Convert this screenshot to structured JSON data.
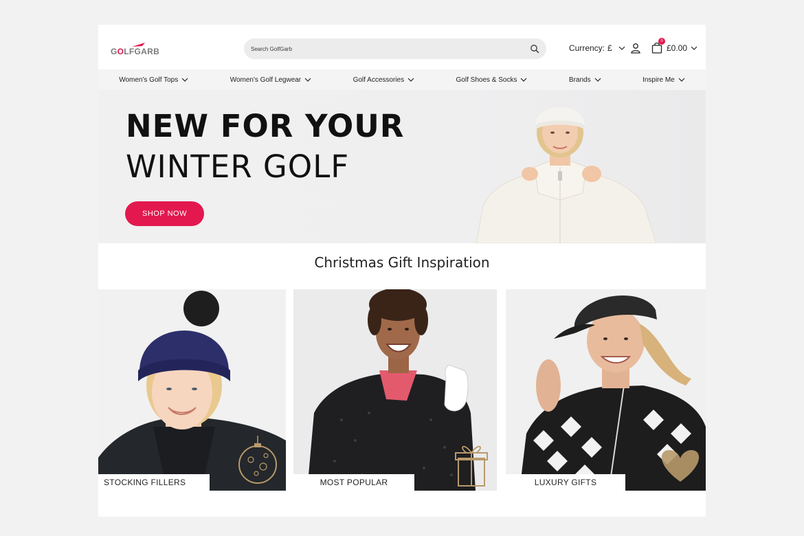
{
  "header": {
    "logo_text_pre": "G",
    "logo_text_o": "O",
    "logo_text_post": "LFGARB",
    "search_placeholder": "Search GolfGarb",
    "currency_label": "Currency:",
    "currency_value": "£",
    "cart_count": "0",
    "cart_total": "£0.00"
  },
  "nav": {
    "items": [
      {
        "label": "Women's Golf Tops"
      },
      {
        "label": "Women's Golf Legwear"
      },
      {
        "label": "Golf Accessories"
      },
      {
        "label": "Golf Shoes & Socks"
      },
      {
        "label": "Brands"
      },
      {
        "label": "Inspire Me"
      }
    ]
  },
  "hero": {
    "line1": "NEW FOR YOUR",
    "line2": "WINTER GOLF",
    "cta": "SHOP NOW"
  },
  "section": {
    "title": "Christmas Gift Inspiration"
  },
  "cards": [
    {
      "label": "STOCKING FILLERS"
    },
    {
      "label": "MOST POPULAR"
    },
    {
      "label": "LUXURY GIFTS"
    }
  ],
  "colors": {
    "accent": "#e3184e",
    "page_bg": "#f2f2f2",
    "nav_bg": "#f4f4f5",
    "gold": "#b89a6a"
  },
  "icons": [
    "search-icon",
    "user-icon",
    "shopping-bag-icon",
    "chevron-down-icon",
    "ornament-bauble-icon",
    "gift-box-icon",
    "heart-icon"
  ]
}
